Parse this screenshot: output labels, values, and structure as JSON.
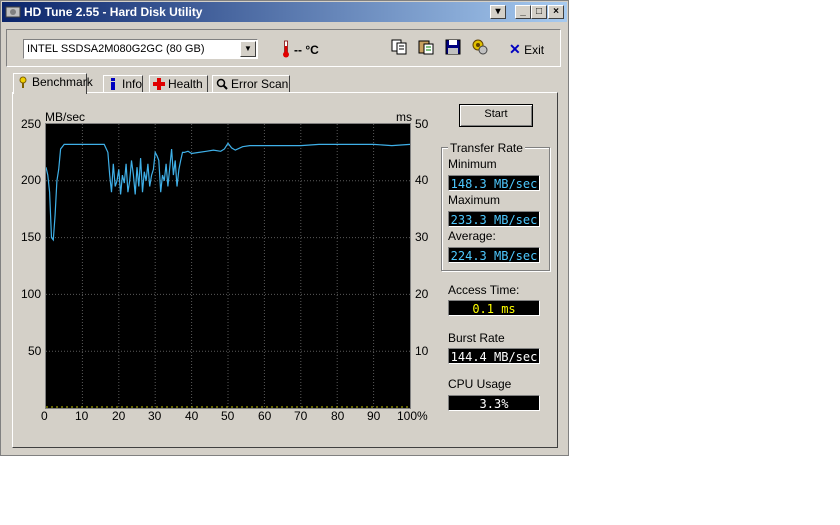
{
  "window": {
    "title": "HD Tune 2.55 - Hard Disk Utility"
  },
  "toolbar": {
    "drive": "INTEL SSDSA2M080G2GC (80 GB)",
    "temperature": "-- °C",
    "exit_label": "Exit"
  },
  "tabs": [
    {
      "label": "Benchmark"
    },
    {
      "label": "Info"
    },
    {
      "label": "Health"
    },
    {
      "label": "Error Scan"
    }
  ],
  "start_label": "Start",
  "graph": {
    "left_unit": "MB/sec",
    "right_unit": "ms",
    "left_ticks": [
      "250",
      "200",
      "150",
      "100",
      "50"
    ],
    "right_ticks": [
      "50",
      "40",
      "30",
      "20",
      "10"
    ],
    "x_ticks": [
      "0",
      "10",
      "20",
      "30",
      "40",
      "50",
      "60",
      "70",
      "80",
      "90",
      "100%"
    ]
  },
  "transfer_rate": {
    "title": "Transfer Rate",
    "minimum_label": "Minimum",
    "minimum": "148.3 MB/sec",
    "maximum_label": "Maximum",
    "maximum": "233.3 MB/sec",
    "average_label": "Average:",
    "average": "224.3 MB/sec"
  },
  "access_time": {
    "label": "Access Time:",
    "value": "0.1 ms"
  },
  "burst_rate": {
    "label": "Burst Rate",
    "value": "144.4 MB/sec"
  },
  "cpu_usage": {
    "label": "CPU Usage",
    "value": "3.3%"
  },
  "chart_data": {
    "type": "line",
    "xlim": [
      0,
      100
    ],
    "ylim": [
      0,
      250
    ],
    "series": [
      {
        "x": [
          0,
          0.5,
          1,
          1.5,
          2,
          2.5,
          3,
          3.5,
          4,
          5,
          6,
          8,
          10,
          12,
          14,
          16,
          17,
          17.5,
          18,
          18.5,
          19,
          19.5,
          20,
          20.5,
          21,
          21.5,
          22,
          22.5,
          23,
          23.5,
          24,
          24.5,
          25,
          25.5,
          26,
          26.5,
          27,
          27.5,
          28,
          28.5,
          29,
          29.5,
          30,
          30.5,
          31,
          31.5,
          32,
          32.5,
          33,
          33.5,
          34,
          34.5,
          35,
          35.5,
          36,
          36.5,
          37,
          37.5,
          38,
          39,
          40,
          42,
          44,
          46,
          48,
          49,
          50,
          51,
          52,
          54,
          56,
          60,
          65,
          70,
          75,
          80,
          85,
          90,
          95,
          100
        ],
        "y": [
          212,
          205,
          190,
          150,
          148,
          170,
          200,
          210,
          228,
          232,
          232,
          232,
          232,
          232,
          232,
          232,
          225,
          205,
          190,
          215,
          195,
          200,
          210,
          188,
          205,
          198,
          215,
          190,
          200,
          218,
          205,
          188,
          212,
          195,
          220,
          190,
          208,
          200,
          215,
          195,
          205,
          210,
          225,
          222,
          218,
          190,
          205,
          200,
          215,
          195,
          212,
          228,
          205,
          218,
          195,
          210,
          218,
          225,
          225,
          226,
          224,
          225,
          226,
          227,
          226,
          228,
          233,
          229,
          227,
          230,
          231,
          231,
          231,
          231,
          232,
          232,
          232,
          232,
          231,
          232
        ]
      },
      {
        "x": [
          0,
          100
        ],
        "y": [
          0,
          0
        ]
      }
    ]
  }
}
